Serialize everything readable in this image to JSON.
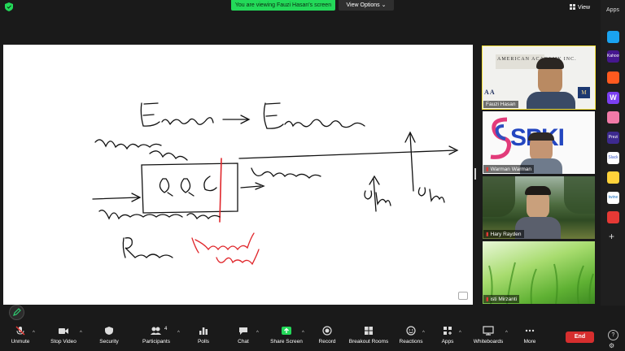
{
  "banner": {
    "text": "You are viewing Fauzi Hasan's screen"
  },
  "view_options": {
    "label": "View Options"
  },
  "view": {
    "label": "View"
  },
  "whiteboard": {
    "lines": [
      "Energe",
      "Energinee",
      "Manufacturing system",
      "QQC",
      "Deliverables",
      "Materials",
      "Process",
      "Reviewer",
      "Assurance",
      "Brading",
      "up",
      "up"
    ]
  },
  "gallery": {
    "tiles": [
      {
        "name": "Fauzi Hasan",
        "banner": "AMERICAN ACADEMY INC.",
        "letters": "A A",
        "side": "M"
      },
      {
        "name": "Warman Warman",
        "logo": "SPKI"
      },
      {
        "name": "Hary Rayden"
      },
      {
        "name": "isti Mirzanti"
      }
    ]
  },
  "apps": {
    "title": "Apps",
    "icons": [
      "Kahoot!",
      "Prezi",
      "Slack",
      "twine",
      "W"
    ]
  },
  "toolbar": {
    "unmute": "Unmute",
    "stop_video": "Stop Video",
    "security": "Security",
    "participants": "Participants",
    "participants_count": "4",
    "polls": "Polls",
    "chat": "Chat",
    "share_screen": "Share Screen",
    "record": "Record",
    "breakout_rooms": "Breakout Rooms",
    "reactions": "Reactions",
    "apps": "Apps",
    "whiteboards": "Whiteboards",
    "more": "More",
    "end": "End"
  },
  "colors": {
    "accent_green": "#23d959",
    "end_red": "#d62e2e",
    "highlight_yellow": "#f5e23a",
    "ink": "#111111",
    "red_ink": "#e0262b"
  }
}
